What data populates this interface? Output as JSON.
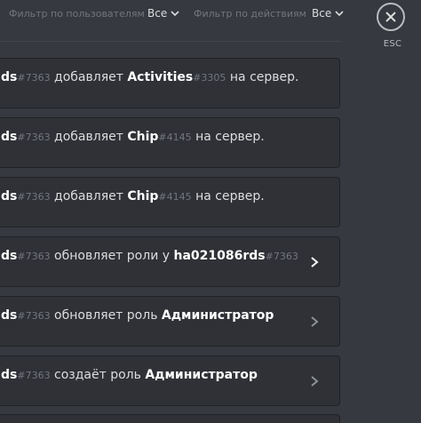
{
  "header": {
    "user_filter_label": "Фильтр по пользователям",
    "user_filter_value": "Все",
    "action_filter_label": "Фильтр по действиям",
    "action_filter_value": "Все"
  },
  "close": {
    "esc_label": "ESC"
  },
  "entries": [
    {
      "user": "ds",
      "user_tag": "#7363",
      "action": "добавляет",
      "target": "Activities",
      "target_tag": "#3305",
      "suffix": "на сервер."
    },
    {
      "user": "ds",
      "user_tag": "#7363",
      "action": "добавляет",
      "target": "Chip",
      "target_tag": "#4145",
      "suffix": "на сервер."
    },
    {
      "user": "ds",
      "user_tag": "#7363",
      "action": "добавляет",
      "target": "Chip",
      "target_tag": "#4145",
      "suffix": "на сервер."
    },
    {
      "user": "ds",
      "user_tag": "#7363",
      "action": "обновляет роли у",
      "target": "ha021086rds",
      "target_tag": "#7363",
      "suffix": ""
    },
    {
      "user": "ds",
      "user_tag": "#7363",
      "action": "обновляет роль",
      "target": "Администратор",
      "target_tag": "",
      "suffix": ""
    },
    {
      "user": "ds",
      "user_tag": "#7363",
      "action": "создаёт роль",
      "target": "Администратор",
      "target_tag": "",
      "suffix": ""
    }
  ]
}
